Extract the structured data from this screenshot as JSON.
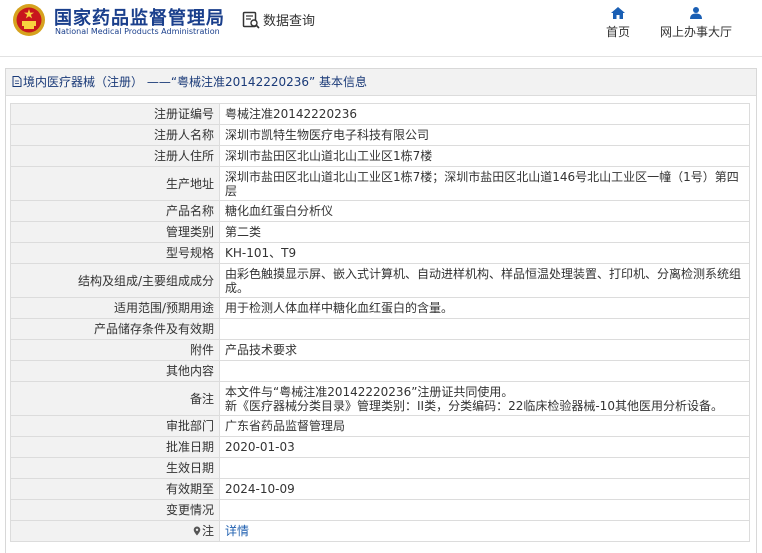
{
  "header": {
    "logo_cn": "国家药品监督管理局",
    "logo_en": "National Medical Products Administration",
    "query_label": "数据查询",
    "nav": [
      {
        "label": "首页",
        "icon": "home-icon"
      },
      {
        "label": "网上办事大厅",
        "icon": "user-icon"
      }
    ]
  },
  "panel": {
    "title": "境内医疗器械（注册） ——“粤械注准20142220236” 基本信息"
  },
  "rows": [
    {
      "label": "注册证编号",
      "value": "粤械注准20142220236"
    },
    {
      "label": "注册人名称",
      "value": "深圳市凯特生物医疗电子科技有限公司"
    },
    {
      "label": "注册人住所",
      "value": "深圳市盐田区北山道北山工业区1栋7楼"
    },
    {
      "label": "生产地址",
      "value": "深圳市盐田区北山道北山工业区1栋7楼；深圳市盐田区北山道146号北山工业区一幢（1号）第四层"
    },
    {
      "label": "产品名称",
      "value": "糖化血红蛋白分析仪"
    },
    {
      "label": "管理类别",
      "value": "第二类"
    },
    {
      "label": "型号规格",
      "value": "KH-101、T9"
    },
    {
      "label": "结构及组成/主要组成成分",
      "value": "由彩色触摸显示屏、嵌入式计算机、自动进样机构、样品恒温处理装置、打印机、分离检测系统组成。"
    },
    {
      "label": "适用范围/预期用途",
      "value": "用于检测人体血样中糖化血红蛋白的含量。"
    },
    {
      "label": "产品储存条件及有效期",
      "value": ""
    },
    {
      "label": "附件",
      "value": "产品技术要求"
    },
    {
      "label": "其他内容",
      "value": ""
    },
    {
      "label": "备注",
      "value": "本文件与“粤械注准20142220236”注册证共同使用。",
      "value2": "新《医疗器械分类目录》管理类别：II类，分类编码：22临床检验器械-10其他医用分析设备。"
    },
    {
      "label": "审批部门",
      "value": "广东省药品监督管理局"
    },
    {
      "label": "批准日期",
      "value": "2020-01-03"
    },
    {
      "label": "生效日期",
      "value": ""
    },
    {
      "label": "有效期至",
      "value": "2024-10-09"
    },
    {
      "label": "变更情况",
      "value": ""
    },
    {
      "label": "注",
      "value": "详情",
      "icon": "pin-icon"
    }
  ],
  "colors": {
    "brand": "#1a3f8c",
    "link": "#2060b0",
    "label_bg": "#f2f2f2",
    "border": "#dcdcdc"
  }
}
